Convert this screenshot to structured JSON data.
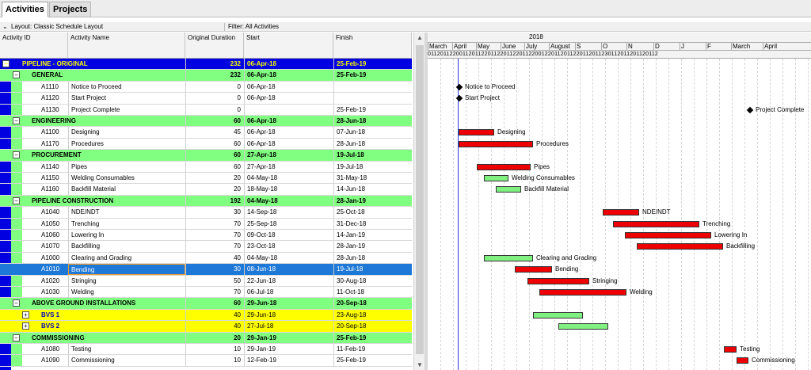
{
  "tabs": {
    "activities": "Activities",
    "projects": "Projects"
  },
  "toolbar": {
    "layout": "Layout: Classic Schedule Layout",
    "filter": "Filter: All Activities"
  },
  "columns": {
    "id": "Activity ID",
    "name": "Activity Name",
    "duration": "Original Duration",
    "start": "Start",
    "finish": "Finish"
  },
  "gantt_header": {
    "year": "2018",
    "months": [
      "March",
      "April",
      "May",
      "June",
      "July",
      "August",
      "S",
      "O",
      "N",
      "D",
      "J",
      "F",
      "March",
      "April"
    ],
    "weeks": "0112011220011201122011220112201122001220112011220112011230112011201120112"
  },
  "rows": [
    {
      "type": "project",
      "name": "PIPELINE - ORIGINAL",
      "duration": "232",
      "start": "06-Apr-18",
      "finish": "25-Feb-19"
    },
    {
      "type": "wbs",
      "name": "GENERAL",
      "duration": "232",
      "start": "06-Apr-18",
      "finish": "25-Feb-19"
    },
    {
      "type": "act",
      "id": "A1110",
      "name": "Notice to Proceed",
      "duration": "0",
      "start": "06-Apr-18",
      "finish": ""
    },
    {
      "type": "act",
      "id": "A1120",
      "name": "Start Project",
      "duration": "0",
      "start": "06-Apr-18",
      "finish": ""
    },
    {
      "type": "act",
      "id": "A1130",
      "name": "Project Complete",
      "duration": "0",
      "start": "",
      "finish": "25-Feb-19"
    },
    {
      "type": "wbs",
      "name": "ENGINEERING",
      "duration": "60",
      "start": "06-Apr-18",
      "finish": "28-Jun-18"
    },
    {
      "type": "act",
      "id": "A1100",
      "name": "Designing",
      "duration": "45",
      "start": "06-Apr-18",
      "finish": "07-Jun-18"
    },
    {
      "type": "act",
      "id": "A1170",
      "name": "Procedures",
      "duration": "60",
      "start": "06-Apr-18",
      "finish": "28-Jun-18"
    },
    {
      "type": "wbs",
      "name": "PROCUREMENT",
      "duration": "60",
      "start": "27-Apr-18",
      "finish": "19-Jul-18"
    },
    {
      "type": "act",
      "id": "A1140",
      "name": "Pipes",
      "duration": "60",
      "start": "27-Apr-18",
      "finish": "19-Jul-18"
    },
    {
      "type": "act",
      "id": "A1150",
      "name": "Welding Consumables",
      "duration": "20",
      "start": "04-May-18",
      "finish": "31-May-18"
    },
    {
      "type": "act",
      "id": "A1160",
      "name": "Backfill Material",
      "duration": "20",
      "start": "18-May-18",
      "finish": "14-Jun-18"
    },
    {
      "type": "wbs",
      "name": "PIPELINE CONSTRUCTION",
      "duration": "192",
      "start": "04-May-18",
      "finish": "28-Jan-19"
    },
    {
      "type": "act",
      "id": "A1040",
      "name": "NDE/NDT",
      "duration": "30",
      "start": "14-Sep-18",
      "finish": "25-Oct-18"
    },
    {
      "type": "act",
      "id": "A1050",
      "name": "Trenching",
      "duration": "70",
      "start": "25-Sep-18",
      "finish": "31-Dec-18"
    },
    {
      "type": "act",
      "id": "A1060",
      "name": "Lowering In",
      "duration": "70",
      "start": "09-Oct-18",
      "finish": "14-Jan-19"
    },
    {
      "type": "act",
      "id": "A1070",
      "name": "Backfilling",
      "duration": "70",
      "start": "23-Oct-18",
      "finish": "28-Jan-19"
    },
    {
      "type": "act",
      "id": "A1000",
      "name": "Clearing and Grading",
      "duration": "40",
      "start": "04-May-18",
      "finish": "28-Jun-18"
    },
    {
      "type": "sel",
      "id": "A1010",
      "name": "Bending",
      "duration": "30",
      "start": "08-Jun-18",
      "finish": "19-Jul-18"
    },
    {
      "type": "act",
      "id": "A1020",
      "name": "Stringing",
      "duration": "50",
      "start": "22-Jun-18",
      "finish": "30-Aug-18"
    },
    {
      "type": "act",
      "id": "A1030",
      "name": "Welding",
      "duration": "70",
      "start": "06-Jul-18",
      "finish": "11-Oct-18"
    },
    {
      "type": "wbs",
      "name": "ABOVE GROUND INSTALLATIONS",
      "duration": "60",
      "start": "29-Jun-18",
      "finish": "20-Sep-18"
    },
    {
      "type": "wbs2",
      "name": "BVS 1",
      "duration": "40",
      "start": "29-Jun-18",
      "finish": "23-Aug-18"
    },
    {
      "type": "wbs2",
      "name": "BVS 2",
      "duration": "40",
      "start": "27-Jul-18",
      "finish": "20-Sep-18"
    },
    {
      "type": "wbs",
      "name": "COMMISSIONING",
      "duration": "20",
      "start": "29-Jan-19",
      "finish": "25-Feb-19"
    },
    {
      "type": "act",
      "id": "A1080",
      "name": "Testing",
      "duration": "10",
      "start": "29-Jan-19",
      "finish": "11-Feb-19"
    },
    {
      "type": "act",
      "id": "A1090",
      "name": "Commissioning",
      "duration": "10",
      "start": "12-Feb-19",
      "finish": "25-Feb-19"
    }
  ],
  "gantt_labels": {
    "notice": "Notice to Proceed",
    "start": "Start Project",
    "complete": "Project Complete",
    "designing": "Designing",
    "procedures": "Procedures",
    "pipes": "Pipes",
    "welding_cons": "Welding Consumables",
    "backfill_mat": "Backfill Material",
    "nde": "NDE/NDT",
    "trenching": "Trenching",
    "lowering": "Lowering In",
    "backfilling": "Backfilling",
    "clearing": "Clearing and Grading",
    "bending": "Bending",
    "stringing": "Stringing",
    "welding": "Welding",
    "testing": "Testing",
    "commissioning": "Commissioning"
  },
  "colors": {
    "project": "#0000e0",
    "wbs": "#80ff80",
    "wbs2": "#ffff00",
    "selected": "#1e78d8",
    "critical": "#ee0000",
    "noncritical": "#80f080"
  }
}
